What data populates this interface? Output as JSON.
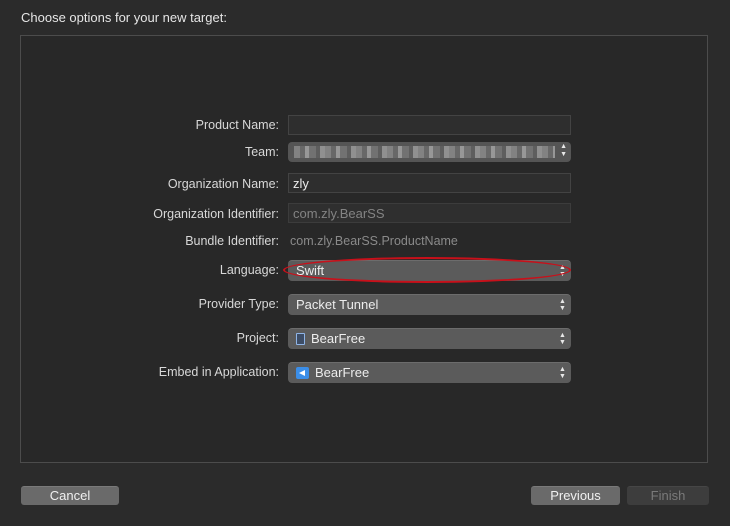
{
  "dialog": {
    "title": "Choose options for your new target:"
  },
  "form": {
    "product_name": {
      "label": "Product Name:",
      "value": ""
    },
    "team": {
      "label": "Team:",
      "value": ""
    },
    "organization_name": {
      "label": "Organization Name:",
      "value": "zly"
    },
    "organization_identifier": {
      "label": "Organization Identifier:",
      "value": "com.zly.BearSS"
    },
    "bundle_identifier": {
      "label": "Bundle Identifier:",
      "value": "com.zly.BearSS.ProductName"
    },
    "language": {
      "label": "Language:",
      "value": "Swift"
    },
    "provider_type": {
      "label": "Provider Type:",
      "value": "Packet Tunnel"
    },
    "project": {
      "label": "Project:",
      "value": "BearFree",
      "icon": "project-file-icon"
    },
    "embed_in_application": {
      "label": "Embed in Application:",
      "value": "BearFree",
      "icon": "app-target-icon"
    }
  },
  "buttons": {
    "cancel": "Cancel",
    "previous": "Previous",
    "finish": "Finish"
  },
  "colors": {
    "highlight": "#c8101a"
  }
}
